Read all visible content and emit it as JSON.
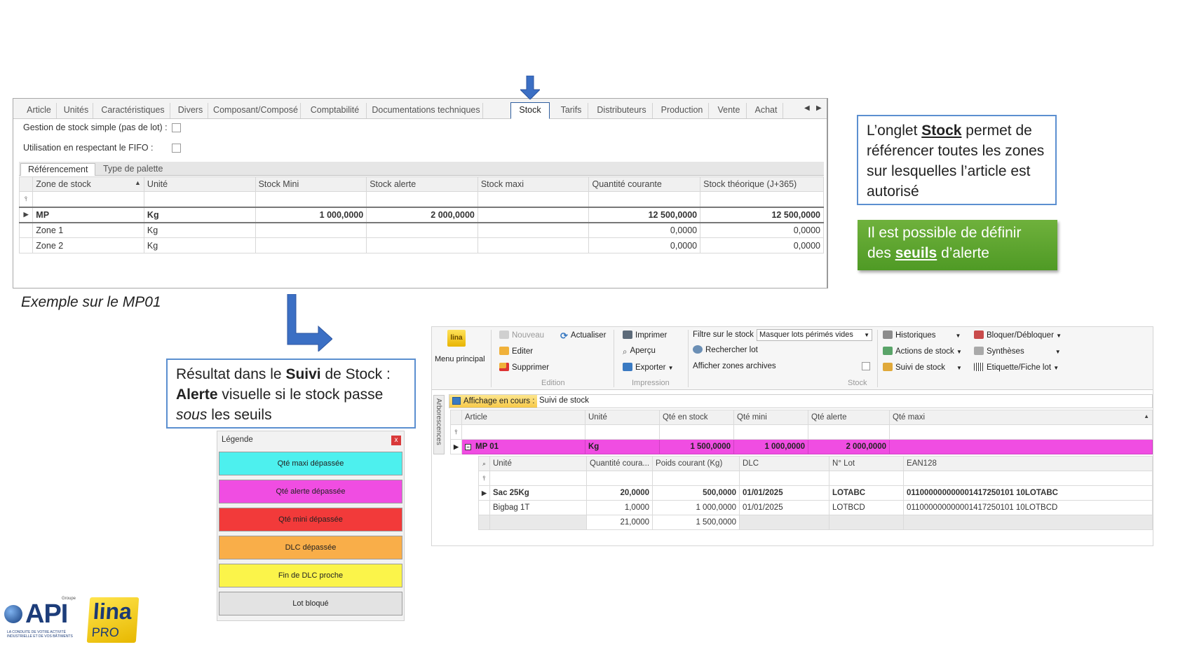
{
  "article_window": {
    "tabs": [
      "Article",
      "Unités",
      "Caractéristiques",
      "Divers",
      "Composant/Composé",
      "Comptabilité",
      "Documentations techniques",
      "Stock",
      "Tarifs",
      "Distributeurs",
      "Production",
      "Vente",
      "Achat"
    ],
    "active_tab": "Stock",
    "checkbox_simple_stock": "Gestion de stock simple (pas de lot) :",
    "checkbox_fifo": "Utilisation en respectant le FIFO :",
    "subtabs": [
      "Référencement",
      "Type de palette"
    ],
    "columns": [
      "Zone de stock",
      "Unité",
      "Stock Mini",
      "Stock alerte",
      "Stock maxi",
      "Quantité courante",
      "Stock théorique (J+365)"
    ],
    "rows": [
      {
        "zone": "MP",
        "unite": "Kg",
        "mini": "1 000,0000",
        "alerte": "2 000,0000",
        "maxi": "",
        "courante": "12 500,0000",
        "theorique": "12 500,0000"
      },
      {
        "zone": "Zone 1",
        "unite": "Kg",
        "mini": "",
        "alerte": "",
        "maxi": "",
        "courante": "0,0000",
        "theorique": "0,0000"
      },
      {
        "zone": "Zone 2",
        "unite": "Kg",
        "mini": "",
        "alerte": "",
        "maxi": "",
        "courante": "0,0000",
        "theorique": "0,0000"
      }
    ]
  },
  "callouts": {
    "stock_pre": "L’onglet ",
    "stock_bold": "Stock",
    "stock_post": " permet de référencer toutes les zones sur lesquelles l’article est autorisé",
    "seuils_pre": "Il est possible de définir des ",
    "seuils_bold": "seuils",
    "seuils_post": " d’alerte",
    "result_1": "Résultat dans le ",
    "result_bold1": "Suivi",
    "result_2": " de Stock : ",
    "result_bold2": "Alerte",
    "result_3": " visuelle si le stock passe ",
    "result_italic": "sous",
    "result_4": " les seuils",
    "example": "Exemple sur le MP01"
  },
  "legend": {
    "title": "Légende",
    "close": "x",
    "items": [
      {
        "label": "Qté maxi dépassée",
        "color": "#4df0ee"
      },
      {
        "label": "Qté alerte dépassée",
        "color": "#f04de2"
      },
      {
        "label": "Qté mini dépassée",
        "color": "#f23a3a"
      },
      {
        "label": "DLC dépassée",
        "color": "#f9ae49"
      },
      {
        "label": "Fin de DLC proche",
        "color": "#fbf44a"
      },
      {
        "label": "Lot bloqué",
        "color": "#e3e3e3"
      }
    ]
  },
  "stock_window": {
    "menu_principal": "Menu principal",
    "edition": {
      "nouveau": "Nouveau",
      "actualiser": "Actualiser",
      "editer": "Editer",
      "supprimer": "Supprimer",
      "group": "Edition"
    },
    "impression": {
      "imprimer": "Imprimer",
      "apercu": "Aperçu",
      "exporter": "Exporter",
      "group": "Impression"
    },
    "stock": {
      "filter_label": "Filtre sur le stock :",
      "filter_value": "Masquer lots périmés vides",
      "rechercher_lot": "Rechercher lot",
      "afficher_archives": "Afficher zones archives",
      "group": "Stock"
    },
    "actions": {
      "historiques": "Historiques",
      "actions_stock": "Actions de stock",
      "suivi_stock": "Suivi de stock",
      "bloquer": "Bloquer/Débloquer",
      "syntheses": "Synthèses",
      "etiquette": "Etiquette/Fiche lot"
    },
    "rail_label": "Arborescences",
    "affichage_label": "Affichage en cours :",
    "affichage_value": "Suivi de stock",
    "columns": [
      "Article",
      "Unité",
      "Qté en stock",
      "Qté mini",
      "Qté alerte",
      "Qté maxi"
    ],
    "main_row": {
      "article": "MP 01",
      "unite": "Kg",
      "stock": "1 500,0000",
      "mini": "1 000,0000",
      "alerte": "2 000,0000",
      "maxi": ""
    },
    "sub_columns": [
      "Unité",
      "Quantité coura...",
      "Poids courant (Kg)",
      "DLC",
      "N° Lot",
      "EAN128"
    ],
    "sub_rows": [
      {
        "unite": "Sac 25Kg",
        "qte": "20,0000",
        "poids": "500,0000",
        "dlc": "01/01/2025",
        "lot": "LOTABC",
        "ean": "011000000000001417250101 10LOTABC"
      },
      {
        "unite": "Bigbag 1T",
        "qte": "1,0000",
        "poids": "1 000,0000",
        "dlc": "01/01/2025",
        "lot": "LOTBCD",
        "ean": "011000000000001417250101 10LOTBCD"
      }
    ],
    "totals": {
      "qte": "21,0000",
      "poids": "1 500,0000"
    }
  },
  "logos": {
    "api": "API",
    "groupe": "Groupe",
    "api_tagline": "LA CONDUITE DE VOTRE ACTIVITÉ INDUSTRIELLE ET DE VOS BÂTIMENTS",
    "lina": "lina",
    "pro": "PRO"
  }
}
